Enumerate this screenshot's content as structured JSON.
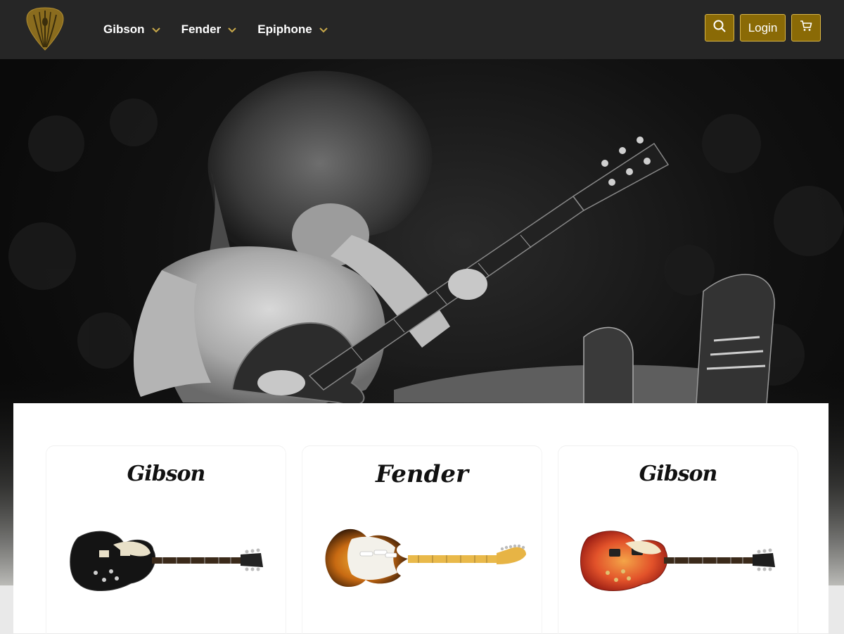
{
  "nav": {
    "items": [
      {
        "label": "Gibson"
      },
      {
        "label": "Fender"
      },
      {
        "label": "Epiphone"
      }
    ],
    "login_label": "Login",
    "search_icon": "search-icon",
    "cart_icon": "cart-icon",
    "logo_icon": "guitar-pick-logo"
  },
  "colors": {
    "navbar_bg": "#262626",
    "accent_gold": "#8a6a06",
    "accent_border": "#d8b548",
    "chevron": "#c9a94a"
  },
  "cards": [
    {
      "brand": "Gibson",
      "guitar": "black-les-paul-guitar"
    },
    {
      "brand": "Fender",
      "guitar": "sunburst-stratocaster-guitar"
    },
    {
      "brand": "Gibson",
      "guitar": "cherry-sunburst-les-paul-guitar"
    }
  ]
}
